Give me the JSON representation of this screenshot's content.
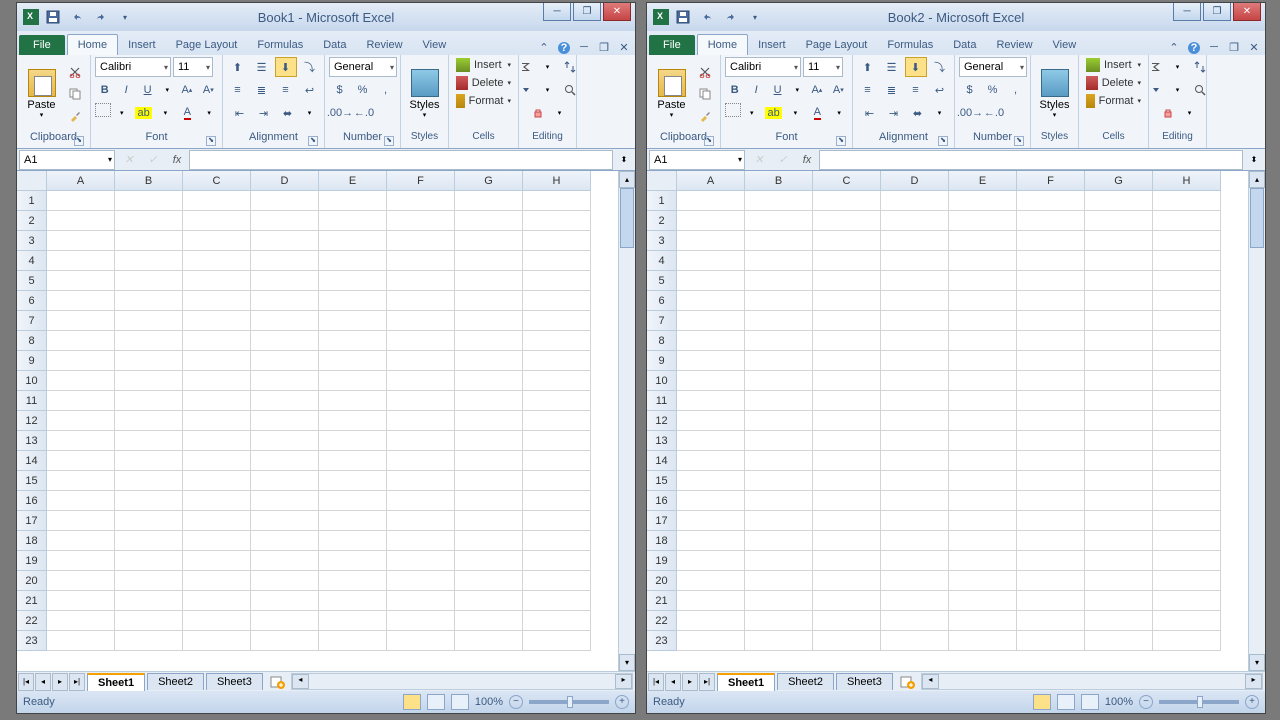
{
  "windows": [
    {
      "title": "Book1 - Microsoft Excel",
      "nameBox": "A1",
      "status": "Ready",
      "zoom": "100%",
      "font": "Calibri",
      "fontSize": "11",
      "numberFormat": "General",
      "sheets": [
        "Sheet1",
        "Sheet2",
        "Sheet3"
      ],
      "activeSheet": 0
    },
    {
      "title": "Book2 - Microsoft Excel",
      "nameBox": "A1",
      "status": "Ready",
      "zoom": "100%",
      "font": "Calibri",
      "fontSize": "11",
      "numberFormat": "General",
      "sheets": [
        "Sheet1",
        "Sheet2",
        "Sheet3"
      ],
      "activeSheet": 0
    }
  ],
  "ribbonTabs": [
    "Home",
    "Insert",
    "Page Layout",
    "Formulas",
    "Data",
    "Review",
    "View"
  ],
  "fileTab": "File",
  "groups": {
    "clipboard": "Clipboard",
    "font": "Font",
    "alignment": "Alignment",
    "number": "Number",
    "styles": "Styles",
    "cells": "Cells",
    "editing": "Editing"
  },
  "buttons": {
    "paste": "Paste",
    "styles": "Styles",
    "insert": "Insert",
    "delete": "Delete",
    "format": "Format"
  },
  "columns": [
    "A",
    "B",
    "C",
    "D",
    "E",
    "F",
    "G",
    "H"
  ],
  "rowCount": 23
}
